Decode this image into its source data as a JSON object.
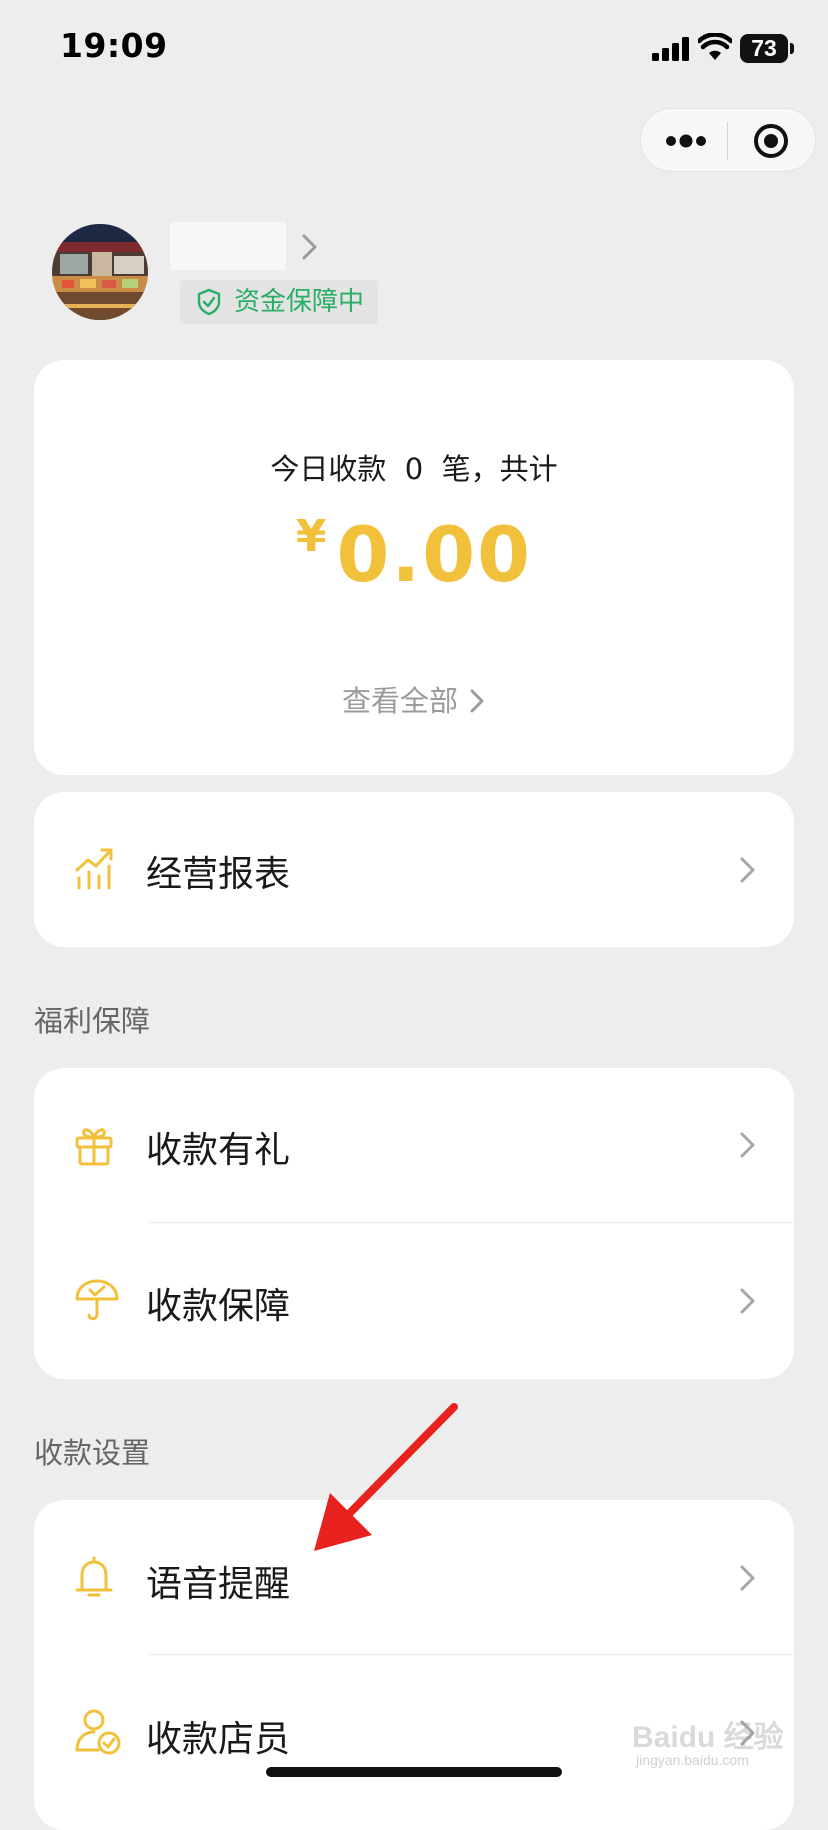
{
  "status_bar": {
    "time": "19:09",
    "battery": "73"
  },
  "capsule": {
    "more_icon": "more-dots-icon",
    "close_icon": "target-close-icon"
  },
  "merchant": {
    "badge": "资金保障中"
  },
  "summary": {
    "line": "今日收款  0  笔，共计",
    "currency": "¥",
    "amount": "0.00",
    "view_all": "查看全部"
  },
  "business_report": {
    "label": "经营报表",
    "icon": "chart-trend-icon"
  },
  "welfare": {
    "title": "福利保障",
    "items": [
      {
        "label": "收款有礼",
        "icon": "gift-icon"
      },
      {
        "label": "收款保障",
        "icon": "umbrella-check-icon"
      }
    ]
  },
  "settings": {
    "title": "收款设置",
    "items": [
      {
        "label": "语音提醒",
        "icon": "bell-icon"
      },
      {
        "label": "收款店员",
        "icon": "staff-check-icon"
      }
    ]
  },
  "watermark": {
    "text": "Baidu 经验",
    "sub": "jingyan.baidu.com"
  },
  "colors": {
    "background": "#ededed",
    "accent_yellow": "#f2c13b",
    "badge_green": "#2aae67",
    "annotation_red": "#e8231f"
  }
}
